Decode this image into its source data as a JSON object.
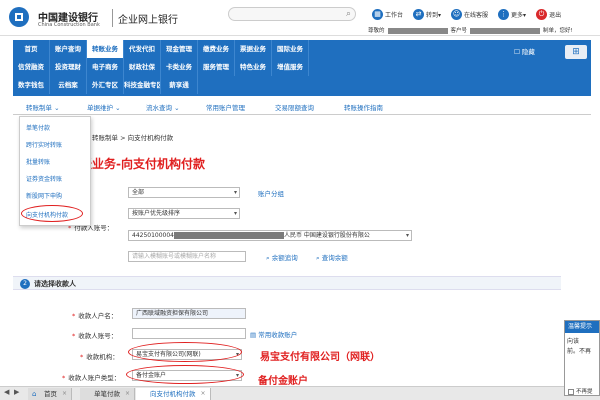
{
  "header": {
    "bank_name_cn": "中国建设银行",
    "bank_name_en": "China Construction Bank",
    "portal_title": "企业网上银行",
    "tools": [
      {
        "icon": "calendar-icon",
        "label": "工作台"
      },
      {
        "icon": "transfer-icon",
        "label": "转到▾"
      },
      {
        "icon": "service-icon",
        "label": "在线客服"
      },
      {
        "icon": "grid-icon",
        "label": "更多▾"
      },
      {
        "icon": "power-icon",
        "label": "退出"
      }
    ],
    "user_prefix": "尊敬的",
    "cust_label": "客户号",
    "user_suffix": "制单，您好!"
  },
  "nav": {
    "row1": [
      "首页",
      "账户查询",
      "转账业务",
      "代发代扣",
      "现金管理",
      "缴费业务",
      "票据业务",
      "国际业务"
    ],
    "row2": [
      "信贷融资",
      "投资理财",
      "电子商务",
      "财政社保",
      "卡类业务",
      "服务管理",
      "特色业务",
      "增值服务"
    ],
    "row3": [
      "数字钱包",
      "云档案",
      "外汇专区",
      "科技金融专区",
      "薪享通"
    ],
    "active": "转账业务",
    "hide_label": "隐藏"
  },
  "subnav": [
    {
      "label": "转账制单 ⌄"
    },
    {
      "label": "单据维护 ⌄"
    },
    {
      "label": "流水查询 ⌄"
    },
    {
      "label": "常用账户管理"
    },
    {
      "label": "交易限额查询"
    },
    {
      "label": "转账操作指南"
    }
  ],
  "dropdown_items": [
    "单笔付款",
    "跨行实时转账",
    "批量转账",
    "证券资金转账",
    "新股网下申购",
    "向支付机构付款"
  ],
  "breadcrumb": "转账制单 > 向支付机构付款",
  "annotations": {
    "title": "转账业务-向支付机构付款",
    "institution": "易宝支付有限公司（网联）",
    "account_type": "备付金账户"
  },
  "payer": {
    "group_value": "全部",
    "group_link": "账户分组",
    "sort_value": "按账户优先级排序",
    "account_label": "付款人账号：",
    "account_prefix": "44250100004",
    "account_suffix": "人民币 中国建设银行股份有限公",
    "search_placeholder": "请输入模糊账号或模糊账户名称",
    "balance_link": "余额追询",
    "detail_link": "查询余额"
  },
  "section2": {
    "number": "2",
    "title": "请选择收款人"
  },
  "payee": {
    "name_label": "收款人户名：",
    "name_value": "广西联域融资担保有限公司",
    "account_label": "收款人账号：",
    "common_link": "常用收款账户",
    "institution_label": "收款机构：",
    "institution_value": "易宝支付有限公司(网联)",
    "type_label": "收款人账户类型：",
    "type_value": "备付金账户"
  },
  "popup": {
    "title": "温馨提示",
    "line1": "向该",
    "line2": "前。不再",
    "checkbox_label": "不再提"
  },
  "tabs": [
    "首页",
    "单笔付款",
    "向支付机构付款"
  ],
  "colors": {
    "brand": "#1f6fbf",
    "annotation_red": "#e02020"
  }
}
